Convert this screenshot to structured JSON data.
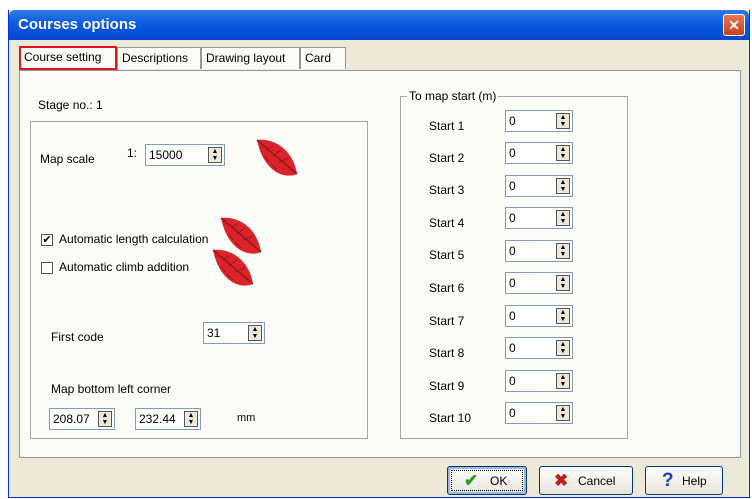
{
  "window": {
    "title": "Courses options"
  },
  "tabs": [
    {
      "label": "Course setting",
      "active": true
    },
    {
      "label": "Descriptions",
      "active": false
    },
    {
      "label": "Drawing layout",
      "active": false
    },
    {
      "label": "Card",
      "active": false
    }
  ],
  "course_setting": {
    "stage_label": "Stage no.: 1",
    "map_scale_label": "Map scale",
    "map_scale_prefix": "1:",
    "map_scale_value": "15000",
    "auto_length_label": "Automatic length calculation",
    "auto_length_checked": true,
    "auto_climb_label": "Automatic climb addition",
    "auto_climb_checked": false,
    "first_code_label": "First code",
    "first_code_value": "31",
    "corner_label": "Map bottom left corner",
    "corner_x": "208.07",
    "corner_y": "232.44",
    "corner_unit": "mm"
  },
  "map_start": {
    "caption": "To map start (m)",
    "rows": [
      {
        "label": "Start 1",
        "value": "0"
      },
      {
        "label": "Start 2",
        "value": "0"
      },
      {
        "label": "Start 3",
        "value": "0"
      },
      {
        "label": "Start 4",
        "value": "0"
      },
      {
        "label": "Start 5",
        "value": "0"
      },
      {
        "label": "Start 6",
        "value": "0"
      },
      {
        "label": "Start 7",
        "value": "0"
      },
      {
        "label": "Start 8",
        "value": "0"
      },
      {
        "label": "Start 9",
        "value": "0"
      },
      {
        "label": "Start 10",
        "value": "0"
      }
    ]
  },
  "buttons": {
    "ok": "OK",
    "cancel": "Cancel",
    "help": "Help"
  },
  "icons": {
    "close": "close-icon",
    "ok": "checkmark-icon",
    "cancel": "x-icon",
    "help": "question-icon",
    "annotation": "red-leaf-icon"
  },
  "colors": {
    "title_bar": "#0a5be3",
    "tab_highlight": "#e0141e",
    "leaf": "#d8242a",
    "ok_check": "#2a9a2a",
    "cancel_x": "#c0201c",
    "help_q": "#1a3fb0"
  }
}
